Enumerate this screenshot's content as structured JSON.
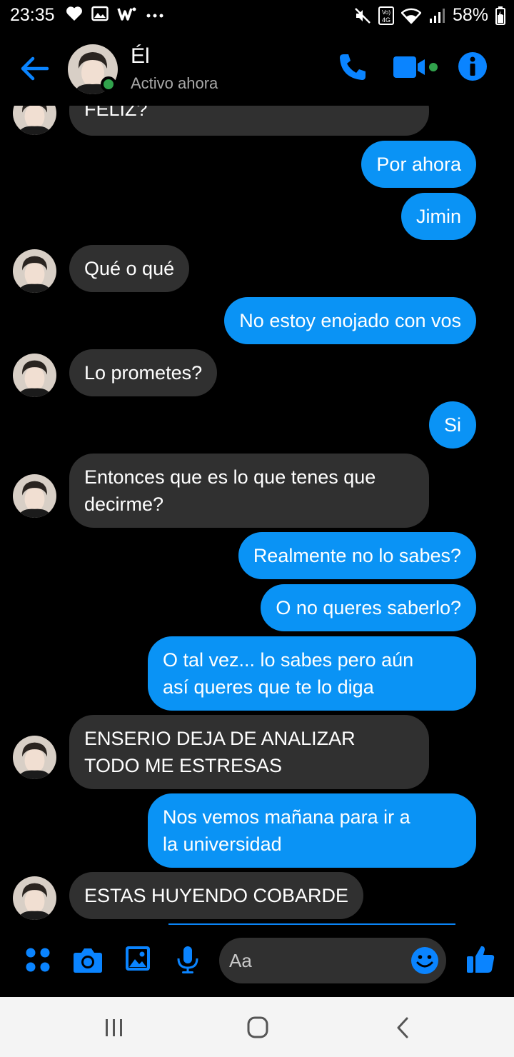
{
  "status_bar": {
    "time": "23:35",
    "battery_text": "58%",
    "left_icons": [
      "heart-icon",
      "gallery-icon",
      "w-app-icon",
      "more-dots-icon"
    ],
    "right_icons": [
      "mute-icon",
      "volte-4g-icon",
      "wifi-icon",
      "signal-icon",
      "battery-icon"
    ],
    "volte_label": "Vo) 4G"
  },
  "header": {
    "contact_name": "Él",
    "contact_status": "Activo ahora",
    "accent_color": "#0a84ff",
    "online_color": "#31a24c"
  },
  "messages": [
    {
      "side": "in",
      "lines": [
        "FELIZ?"
      ],
      "avatar": true
    },
    {
      "side": "out",
      "lines": [
        "Por ahora"
      ]
    },
    {
      "side": "out",
      "lines": [
        "Jimin"
      ]
    },
    {
      "side": "in",
      "lines": [
        "Qué o qué"
      ],
      "avatar": true
    },
    {
      "side": "out",
      "lines": [
        "No estoy enojado con vos"
      ]
    },
    {
      "side": "in",
      "lines": [
        "Lo prometes?"
      ],
      "avatar": true
    },
    {
      "side": "out",
      "lines": [
        "Si"
      ]
    },
    {
      "side": "in",
      "lines": [
        "Entonces que es lo que tenes que",
        "decirme?"
      ],
      "avatar": true
    },
    {
      "side": "out",
      "lines": [
        "Realmente no lo sabes?"
      ]
    },
    {
      "side": "out",
      "lines": [
        "O no queres saberlo?"
      ]
    },
    {
      "side": "out",
      "lines": [
        "O tal vez... lo sabes pero aún",
        "así queres que te lo diga"
      ]
    },
    {
      "side": "in",
      "lines": [
        "ENSERIO DEJA DE ANALIZAR",
        "TODO ME ESTRESAS"
      ],
      "avatar": true
    },
    {
      "side": "out",
      "lines": [
        "Nos vemos mañana para ir a",
        "la universidad"
      ]
    },
    {
      "side": "in",
      "lines": [
        "ESTAS HUYENDO COBARDE"
      ],
      "avatar": true
    }
  ],
  "composer": {
    "placeholder": "Aa",
    "icons": [
      "apps-grid-icon",
      "camera-icon",
      "photo-icon",
      "microphone-icon",
      "emoji-icon",
      "thumbs-up-icon"
    ]
  },
  "colors": {
    "outgoing_bubble": "#0a93f5",
    "incoming_bubble": "#303030",
    "background": "#000000",
    "nav_background": "#f4f4f4"
  }
}
